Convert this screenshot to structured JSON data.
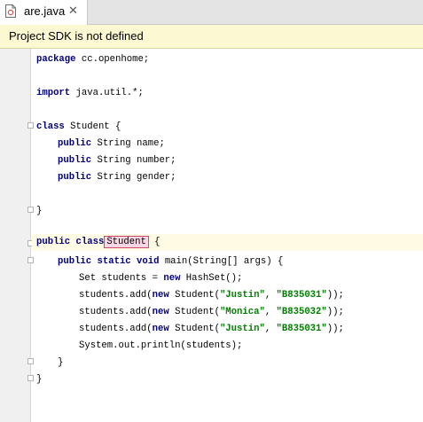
{
  "tab": {
    "filename": "are.java",
    "close": "✕",
    "file_icon": "java-file-icon"
  },
  "banner": {
    "message": "Project SDK is not defined"
  },
  "code": {
    "l1": [
      "package",
      " cc.openhome;"
    ],
    "l2": [
      "import",
      " java.util.*;"
    ],
    "l3": [
      "class",
      " Student {"
    ],
    "l4": [
      "public",
      " String name;"
    ],
    "l5": [
      "public",
      " String number;"
    ],
    "l6": [
      "public",
      " String gender;"
    ],
    "l7": "}",
    "l8": [
      "public",
      "class",
      "Student",
      " {"
    ],
    "l9": [
      "public",
      "static",
      "void",
      " main(String[] args) {"
    ],
    "l10": [
      "Set students = ",
      "new",
      " HashSet();"
    ],
    "l11": [
      "students.add(",
      "new",
      " Student(",
      "\"Justin\"",
      ", ",
      "\"B835031\"",
      "));"
    ],
    "l12": [
      "students.add(",
      "new",
      " Student(",
      "\"Monica\"",
      ", ",
      "\"B835032\"",
      "));"
    ],
    "l13": [
      "students.add(",
      "new",
      " Student(",
      "\"Justin\"",
      ", ",
      "\"B835031\"",
      "));"
    ],
    "l14": "System.out.println(students);",
    "l15": "}",
    "l16": "}"
  }
}
